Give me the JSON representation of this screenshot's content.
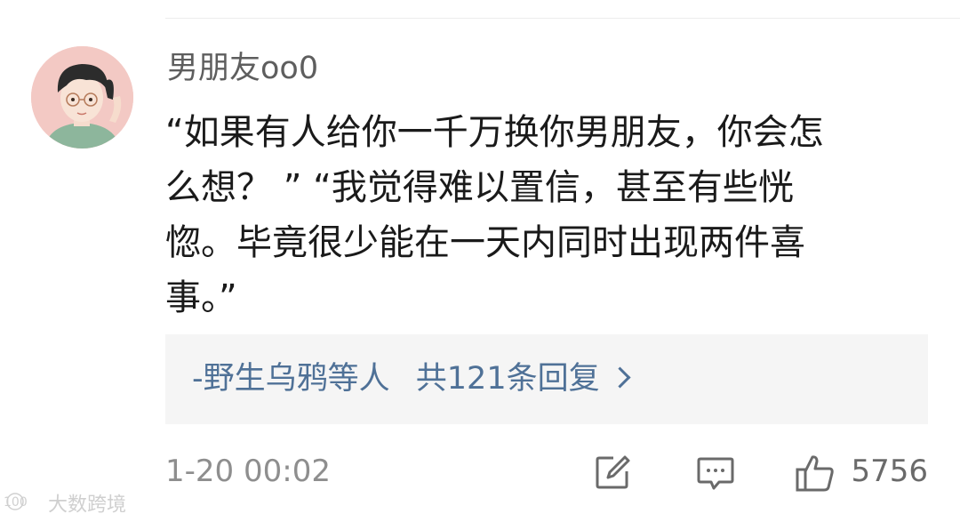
{
  "comment": {
    "username": "男朋友oo0",
    "text_lines": [
      "“如果有人给你一千万换你男朋友，你会怎",
      "么想？ ” “我觉得难以置信，甚至有些恍",
      "惚。毕竟很少能在一天内同时出现两件喜",
      "事。”"
    ],
    "replies_prefix": "-野生乌鸦等人",
    "replies_count_label": "共121条回复",
    "timestamp": "1-20 00:02",
    "like_count": "5756"
  },
  "icons": {
    "edit": "edit-icon",
    "comment": "comment-icon",
    "like": "thumbs-up-icon",
    "reply_chevron": "chevron-right-icon"
  },
  "colors": {
    "link": "#4f7197",
    "reply_bg": "#f5f5f5",
    "meta_text": "#8e8e8e",
    "avatar_bg": "#f3c9c4"
  },
  "watermark": {
    "text": "大数跨境"
  }
}
